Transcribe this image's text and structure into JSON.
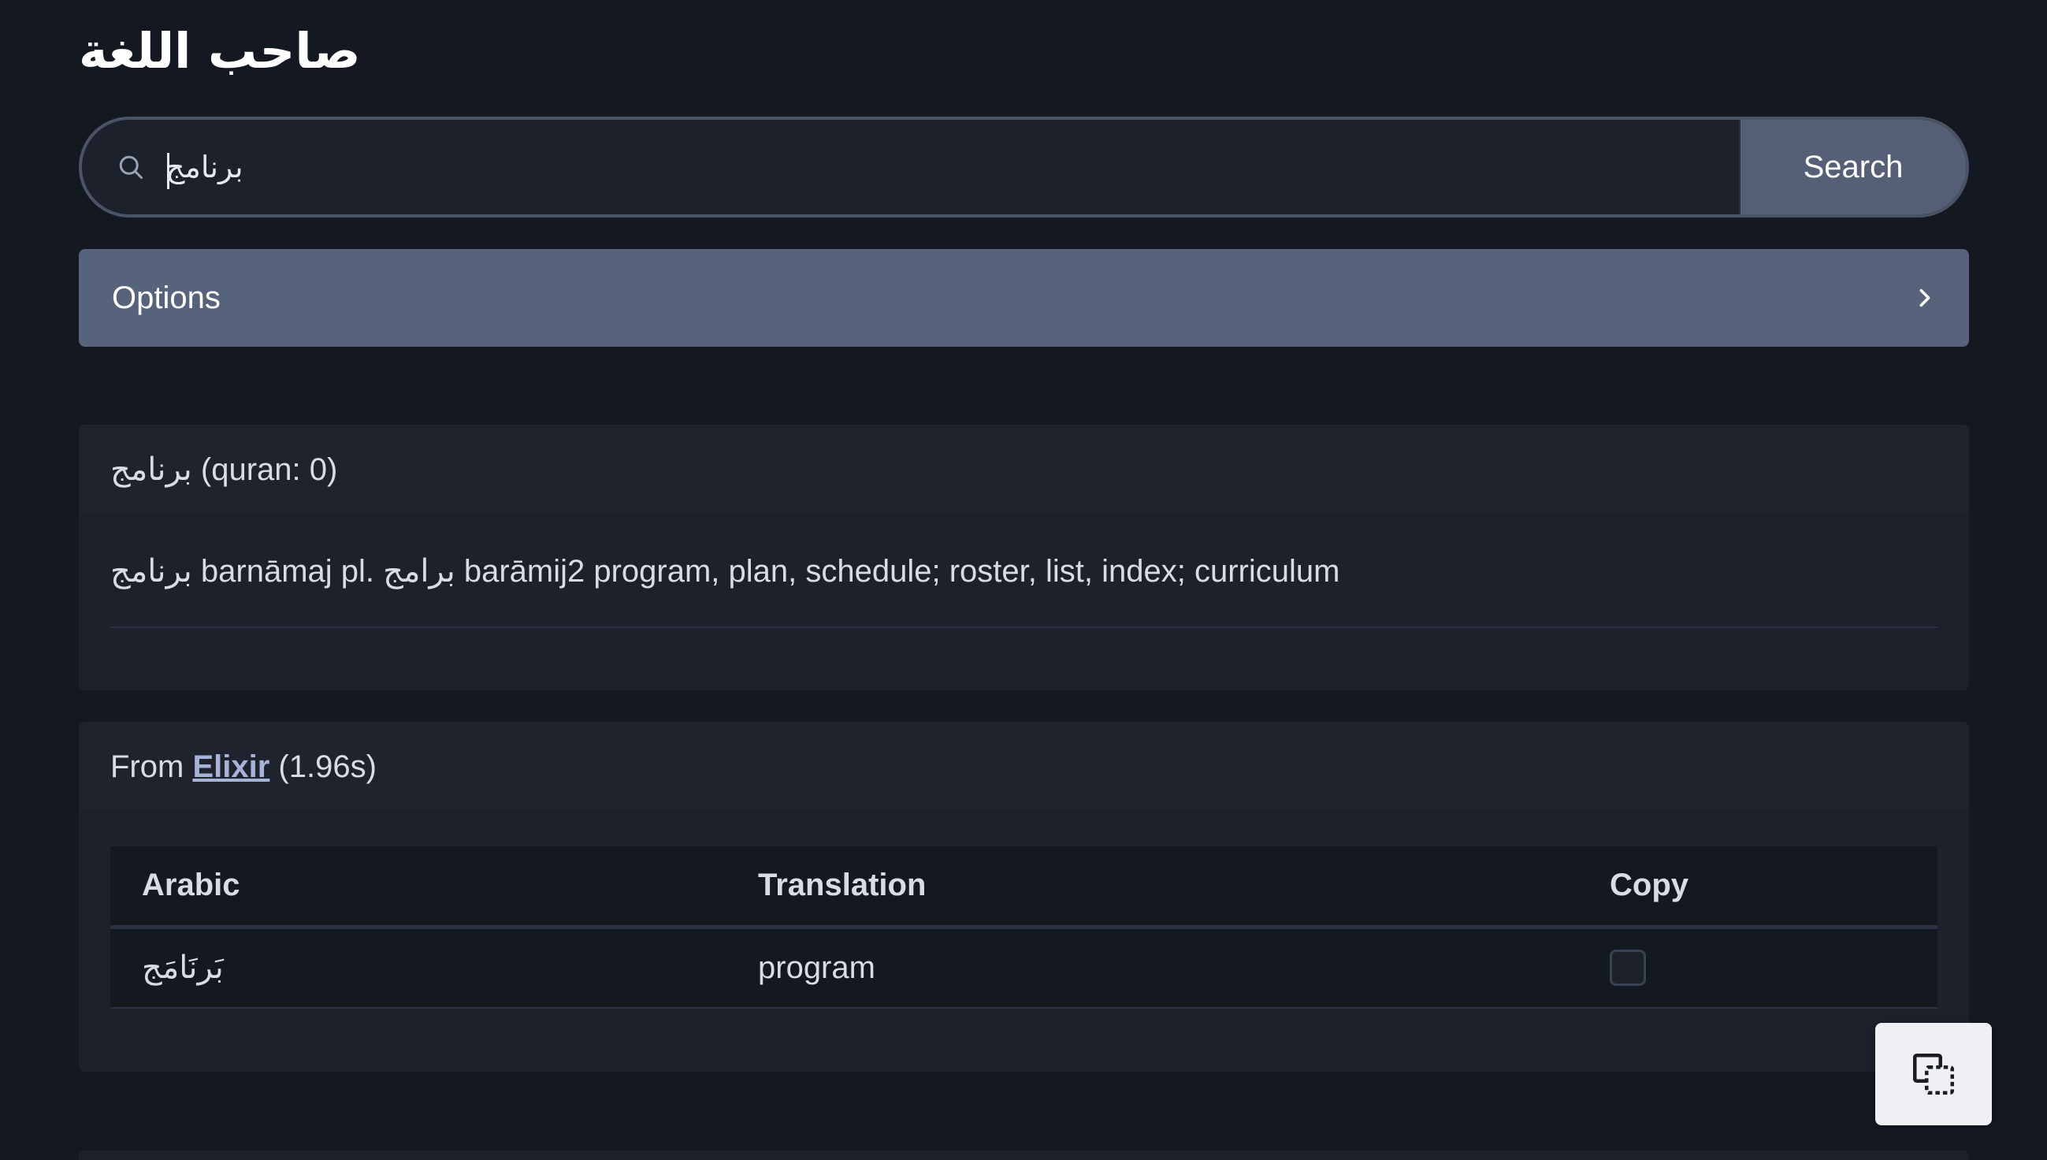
{
  "site": {
    "title": "صاحب اللغة"
  },
  "search": {
    "value": "برنامج",
    "button_label": "Search"
  },
  "options": {
    "label": "Options"
  },
  "dictionary_entry": {
    "header_word": "برنامج",
    "header_meta": "(quran: 0)",
    "definition": {
      "word": "برنامج",
      "translit": "barnāmaj pl.",
      "plural": "برامج",
      "meaning": "barāmij2 program, plan, schedule; roster, list, index; curriculum"
    }
  },
  "source_results": {
    "prefix": "From",
    "source_name": "Elixir",
    "timing": "(1.96s)",
    "columns": [
      "Arabic",
      "Translation",
      "Copy"
    ],
    "rows": [
      {
        "arabic": "بَرنَامَج",
        "translation": "program",
        "copy_checked": false
      }
    ]
  },
  "icons": {
    "search": "search-icon",
    "options_chevron": "chevron-right-icon",
    "floating_copy": "copy-select-icon"
  },
  "colors": {
    "background": "#141821",
    "card": "#1c212c",
    "accent": "#56637a",
    "link": "#a6b3d6"
  }
}
